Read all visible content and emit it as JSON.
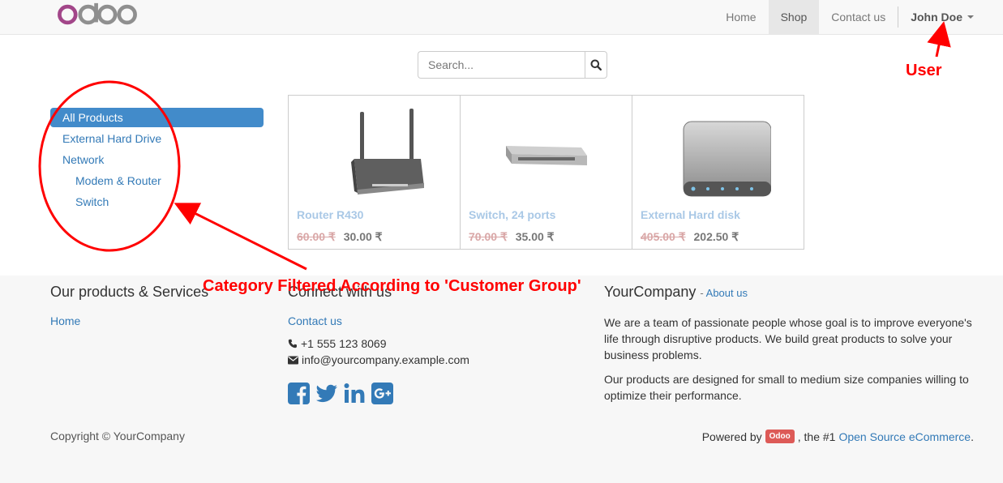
{
  "navbar": {
    "logo_text": "odoo",
    "items": [
      {
        "label": "Home"
      },
      {
        "label": "Shop",
        "active": true
      },
      {
        "label": "Contact us"
      }
    ],
    "user_label": "John Doe"
  },
  "search": {
    "placeholder": "Search..."
  },
  "categories": [
    {
      "label": "All Products",
      "active": true
    },
    {
      "label": "External Hard Drive"
    },
    {
      "label": "Network"
    },
    {
      "label": "Modem & Router",
      "sub": true
    },
    {
      "label": "Switch",
      "sub": true
    }
  ],
  "products": [
    {
      "name": "Router R430",
      "old_price": "60.00 ₹",
      "price": "30.00 ₹",
      "icon": "router-image"
    },
    {
      "name": "Switch, 24 ports",
      "old_price": "70.00 ₹",
      "price": "35.00 ₹",
      "icon": "switch-image"
    },
    {
      "name": "External Hard disk",
      "old_price": "405.00 ₹",
      "price": "202.50 ₹",
      "icon": "hard-disk-image"
    }
  ],
  "footer": {
    "col1": {
      "heading": "Our products & Services",
      "links": [
        "Home"
      ]
    },
    "col2": {
      "heading": "Connect with us",
      "link": "Contact us",
      "phone": "+1 555 123 8069",
      "email": "info@yourcompany.example.com"
    },
    "col3": {
      "heading": "YourCompany",
      "about_link": "About us",
      "para1": "We are a team of passionate people whose goal is to improve everyone's life through disruptive products. We build great products to solve your business problems.",
      "para2": "Our products are designed for small to medium size companies willing to optimize their performance."
    },
    "copyright": "Copyright © YourCompany",
    "powered_prefix": "Powered by",
    "powered_badge": "Odoo",
    "powered_mid": ", the #1",
    "powered_link": "Open Source eCommerce",
    "powered_suffix": "."
  },
  "annotations": {
    "user": "User",
    "category": "Category Filtered According to 'Customer Group'"
  },
  "colors": {
    "annotation": "#ff0000",
    "primary": "#428bca",
    "odoo_badge": "#dd5a57"
  }
}
